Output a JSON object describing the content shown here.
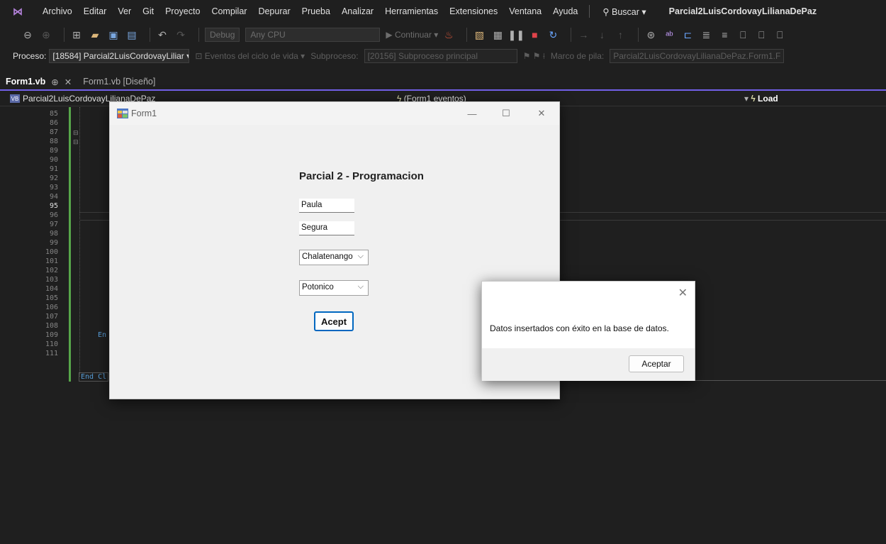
{
  "menubar": {
    "items": [
      "Archivo",
      "Editar",
      "Ver",
      "Git",
      "Proyecto",
      "Compilar",
      "Depurar",
      "Prueba",
      "Analizar",
      "Herramientas",
      "Extensiones",
      "Ventana",
      "Ayuda"
    ],
    "search_label": "Buscar",
    "solution_title": "Parcial2LuisCordovayLilianaDePaz"
  },
  "toolbar1": {
    "config": "Debug",
    "platform": "Any CPU",
    "continue_label": "Continuar"
  },
  "toolbar2": {
    "process_label": "Proceso:",
    "process_value": "[18584] Parcial2LuisCordovayLiliar",
    "lifecycle_label": "Eventos del ciclo de vida",
    "thread_label": "Subproceso:",
    "thread_value": "[20156] Subproceso principal",
    "stack_label": "Marco de pila:",
    "stack_value": "Parcial2LuisCordovayLilianaDePaz.Form1.F"
  },
  "tabs": [
    {
      "label": "Form1.vb",
      "pin": "⊕",
      "close": "✕"
    },
    {
      "label": "Form1.vb [Diseño]"
    }
  ],
  "navbar": {
    "project": "Parcial2LuisCordovayLilianaDePaz",
    "vb_badge": "VB",
    "events": "(Form1 eventos)",
    "member": "Load"
  },
  "editor": {
    "line_numbers": [
      "85",
      "86",
      "87",
      "88",
      "89",
      "90",
      "91",
      "92",
      "93",
      "94",
      "95",
      "96",
      "97",
      "98",
      "99",
      "100",
      "101",
      "102",
      "103",
      "104",
      "105",
      "106",
      "107",
      "108",
      "109",
      "110",
      "111"
    ],
    "current_line": "95",
    "code_end": "En",
    "code_end_class": "End Cl"
  },
  "form1": {
    "title": "Form1",
    "minimize": "—",
    "maximize": "☐",
    "close": "✕",
    "heading": "Parcial 2 - Programacion",
    "first_name": "Paula",
    "last_name": "Segura",
    "department": "Chalatenango",
    "municipality": "Potonico",
    "accept_button": "Acept"
  },
  "msgbox": {
    "close": "✕",
    "message": "Datos insertados con éxito en la base de datos.",
    "ok_button": "Aceptar"
  }
}
